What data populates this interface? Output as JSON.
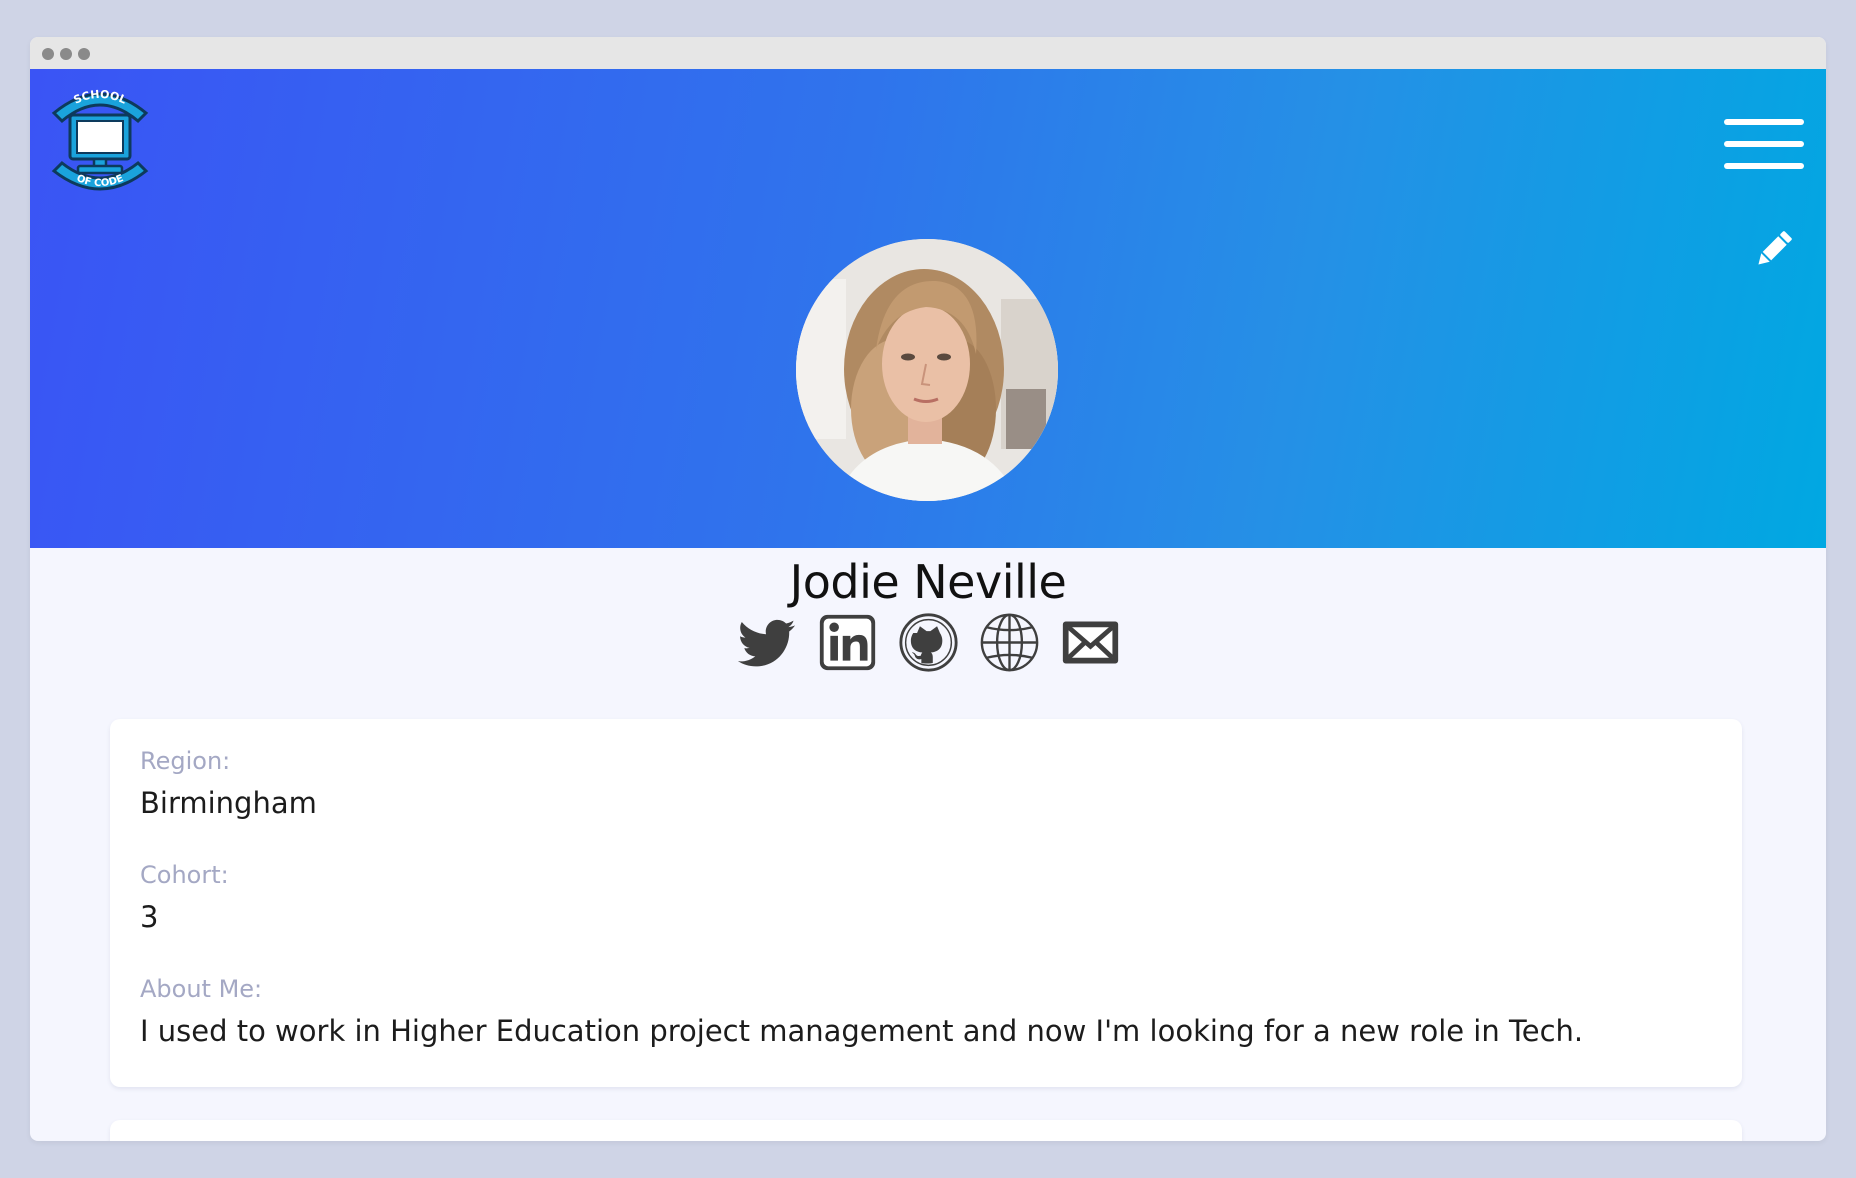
{
  "app": {
    "logo_top_text": "SCHOOL",
    "logo_bottom_text": "OF CODE"
  },
  "colors": {
    "hero_start": "#3a54f5",
    "hero_end": "#00a8e2",
    "page_bg": "#f5f6fe",
    "icon_gray": "#3f3f3f",
    "label_gray": "#a4a8c4"
  },
  "profile": {
    "name": "Jodie Neville",
    "avatar_icon": "profile-photo",
    "socials": [
      {
        "icon": "twitter-icon"
      },
      {
        "icon": "linkedin-icon"
      },
      {
        "icon": "github-icon"
      },
      {
        "icon": "globe-icon"
      },
      {
        "icon": "email-icon"
      }
    ]
  },
  "details": {
    "region_label": "Region:",
    "region_value": "Birmingham",
    "cohort_label": "Cohort:",
    "cohort_value": "3",
    "about_label": "About Me:",
    "about_value": "I used to work in Higher Education project management and now I'm looking for a new role in Tech."
  }
}
